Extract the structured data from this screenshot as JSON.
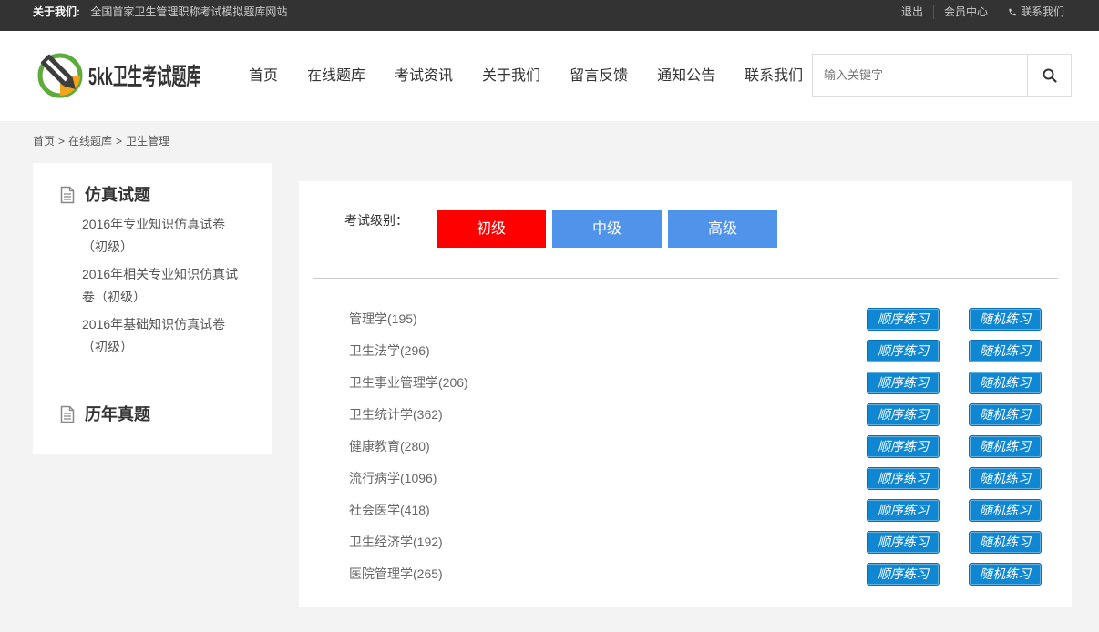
{
  "topbar": {
    "about_label": "关于我们:",
    "slogan": "全国首家卫生管理职称考试模拟题库网站",
    "logout": "退出",
    "member_center": "会员中心",
    "contact": "联系我们",
    "contact_icon": "phone-icon"
  },
  "header": {
    "logo_text": "5kk卫生考试题库",
    "logo_icon": "pencil-logo-icon",
    "nav": [
      "首页",
      "在线题库",
      "考试资讯",
      "关于我们",
      "留言反馈",
      "通知公告",
      "联系我们"
    ],
    "search": {
      "placeholder": "输入关键字",
      "value": "",
      "icon": "search-icon"
    }
  },
  "breadcrumb": {
    "items": [
      "首页",
      "在线题库",
      "卫生管理"
    ],
    "separator": ">"
  },
  "sidebar": {
    "sections": [
      {
        "title": "仿真试题",
        "icon": "document-icon",
        "items": [
          "2016年专业知识仿真试卷（初级）",
          "2016年相关专业知识仿真试卷（初级）",
          "2016年基础知识仿真试卷（初级）"
        ]
      },
      {
        "title": "历年真题",
        "icon": "document-icon"
      }
    ]
  },
  "main": {
    "level_label": "考试级别：",
    "levels": [
      {
        "label": "初级",
        "active": true
      },
      {
        "label": "中级",
        "active": false
      },
      {
        "label": "高级",
        "active": false
      }
    ],
    "sequential_label": "顺序练习",
    "random_label": "随机练习",
    "subjects": [
      {
        "label": "管理学(195)"
      },
      {
        "label": "卫生法学(296)"
      },
      {
        "label": "卫生事业管理学(206)"
      },
      {
        "label": "卫生统计学(362)"
      },
      {
        "label": "健康教育(280)"
      },
      {
        "label": "流行病学(1096)"
      },
      {
        "label": "社会医学(418)"
      },
      {
        "label": "卫生经济学(192)"
      },
      {
        "label": "医院管理学(265)"
      }
    ]
  },
  "colors": {
    "top_bar": "#333333",
    "page_background": "#f3f3f3",
    "active_level": "#ff0000",
    "level": "#4f93ea",
    "practice_button": "#0f87d2"
  }
}
